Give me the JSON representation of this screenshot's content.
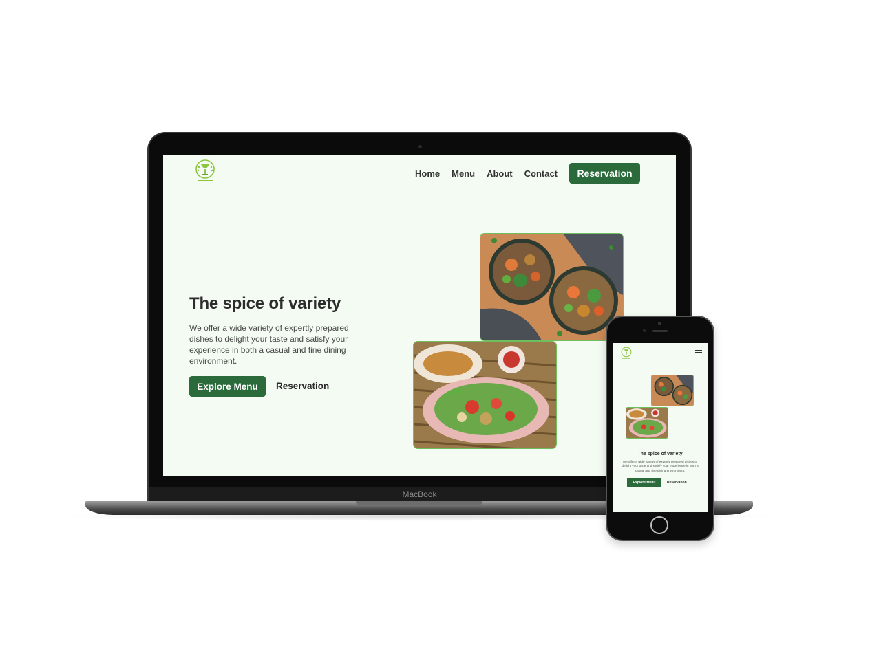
{
  "laptop": {
    "brand": "MacBook"
  },
  "site": {
    "logo_icon": "wine-glass-laurel-logo",
    "nav": {
      "links": [
        "Home",
        "Menu",
        "About",
        "Contact"
      ],
      "cta": "Reservation"
    },
    "hero": {
      "title": "The spice of variety",
      "description": "We offer a wide variety of expertly prepared dishes to delight your taste and satisfy your experience in both a casual and fine dining environment.",
      "primary_button": "Explore Menu",
      "secondary_button": "Reservation"
    },
    "images": [
      "noodle-bowls-photo",
      "papaya-salad-photo"
    ]
  },
  "mobile": {
    "menu_icon": "hamburger-menu-icon",
    "title": "The spice of variety",
    "description": "We offer a wide variety of expertly prepared dishes to delight your taste and satisfy your experience in both a casual and fine dining environment.",
    "primary_button": "Explore Menu",
    "secondary_button": "Reservation"
  },
  "colors": {
    "accent": "#2a6a3b",
    "page_background": "#f3fbf2",
    "image_border": "#6fbf5f"
  }
}
